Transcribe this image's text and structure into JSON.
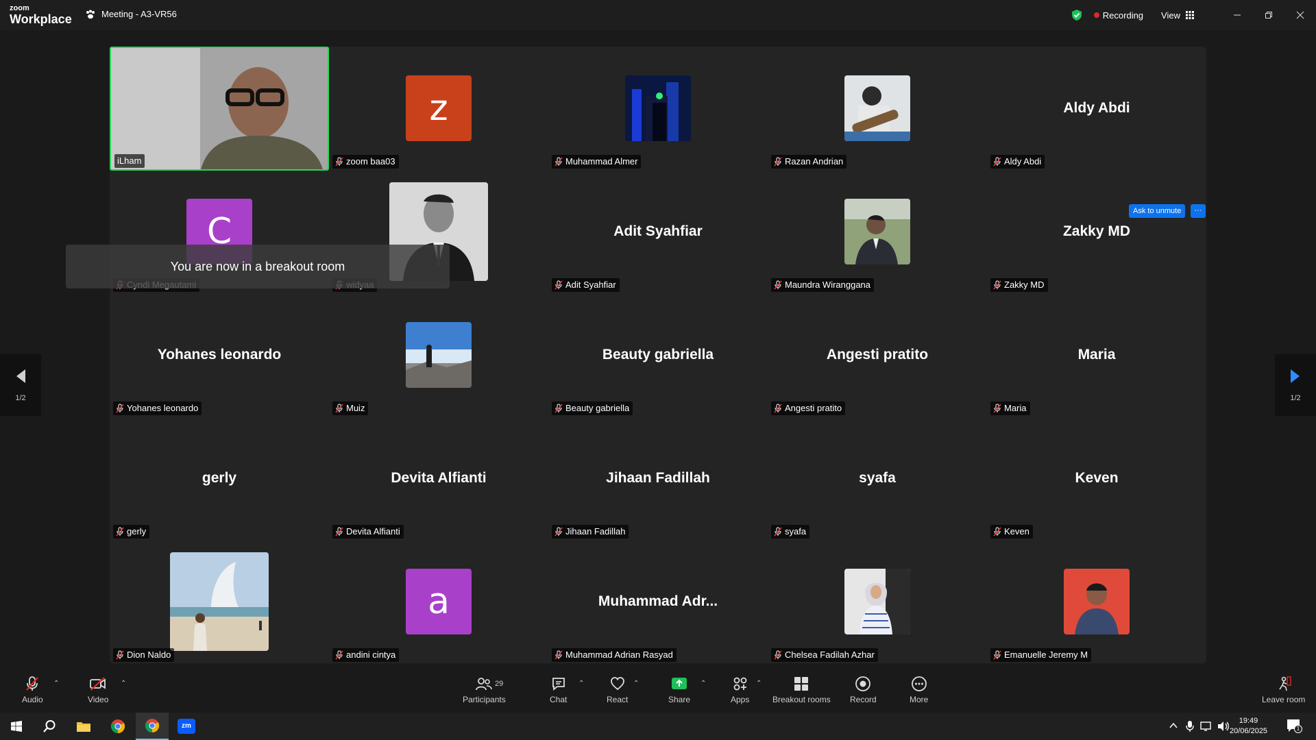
{
  "app": {
    "logo_top": "zoom",
    "logo_bottom": "Workplace",
    "meeting_title": "Meeting - A3-VR56",
    "recording": "Recording",
    "view": "View"
  },
  "toast": "You are now in a breakout room",
  "ask_to_unmute": "Ask to unmute",
  "more_dots": "···",
  "pager": {
    "left": "1/2",
    "right": "1/2"
  },
  "tiles": [
    {
      "label": "iLham",
      "type": "video"
    },
    {
      "label": "zoom baa03",
      "type": "letter",
      "letter": "z",
      "color": "#c8411b"
    },
    {
      "label": "Muhammad Almer",
      "type": "photo",
      "photo": "night-city"
    },
    {
      "label": "Razan Andrian",
      "type": "photo",
      "photo": "guitar"
    },
    {
      "label": "Aldy Abdi",
      "type": "name",
      "big": "Aldy Abdi"
    },
    {
      "label": "Cyndi Megautami",
      "type": "letter",
      "letter": "C",
      "color": "#a940c9"
    },
    {
      "label": "widyaa",
      "type": "photo-lg",
      "photo": "suit-bw"
    },
    {
      "label": "Adit Syahfiar",
      "type": "name",
      "big": "Adit Syahfiar"
    },
    {
      "label": "Maundra Wiranggana",
      "type": "photo",
      "photo": "suit-outdoor"
    },
    {
      "label": "Zakky MD",
      "type": "name",
      "big": "Zakky MD"
    },
    {
      "label": "Yohanes leonardo",
      "type": "name",
      "big": "Yohanes leonardo"
    },
    {
      "label": "Muiz",
      "type": "photo",
      "photo": "mountain"
    },
    {
      "label": "Beauty gabriella",
      "type": "name",
      "big": "Beauty gabriella"
    },
    {
      "label": "Angesti pratito",
      "type": "name",
      "big": "Angesti pratito"
    },
    {
      "label": "Maria",
      "type": "name",
      "big": "Maria"
    },
    {
      "label": "gerly",
      "type": "name",
      "big": "gerly"
    },
    {
      "label": "Devita Alfianti",
      "type": "name",
      "big": "Devita Alfianti"
    },
    {
      "label": "Jihaan Fadillah",
      "type": "name",
      "big": "Jihaan Fadillah"
    },
    {
      "label": "syafa",
      "type": "name",
      "big": "syafa"
    },
    {
      "label": "Keven",
      "type": "name",
      "big": "Keven"
    },
    {
      "label": "Dion Naldo",
      "type": "photo-lg",
      "photo": "beach"
    },
    {
      "label": "andini cintya",
      "type": "letter",
      "letter": "a",
      "color": "#a940c9"
    },
    {
      "label": "Muhammad Adrian Rasyad",
      "type": "name",
      "big": "Muhammad  Adr..."
    },
    {
      "label": "Chelsea Fadilah Azhar",
      "type": "photo",
      "photo": "hijab"
    },
    {
      "label": "Emanuelle Jeremy M",
      "type": "photo",
      "photo": "red-portrait"
    }
  ],
  "toolbar": {
    "audio": "Audio",
    "video": "Video",
    "participants": "Participants",
    "participants_count": "29",
    "chat": "Chat",
    "react": "React",
    "share": "Share",
    "apps": "Apps",
    "breakout": "Breakout rooms",
    "record": "Record",
    "more": "More",
    "leave": "Leave room"
  },
  "taskbar": {
    "time": "19:49",
    "date": "20/06/2025",
    "notif_count": "1"
  },
  "colors": {
    "accent": "#0e72ed",
    "active_border": "#23d959",
    "record_red": "#e02828",
    "share_green": "#1fbf5a"
  }
}
